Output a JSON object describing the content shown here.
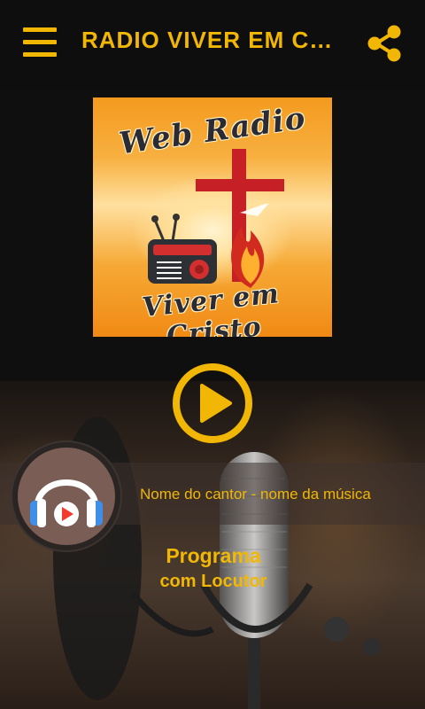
{
  "header": {
    "title": "RADIO VIVER EM CRIS...",
    "menu_icon": "hamburger-menu-icon",
    "share_icon": "share-icon"
  },
  "logo": {
    "line1": "Web Radio",
    "line2": "Viver em Cristo"
  },
  "player": {
    "play_icon": "play-icon",
    "now_playing": "Nome do cantor - nome da música",
    "avatar_icon": "headphones-play-icon"
  },
  "program": {
    "title": "Programa",
    "host": "com Locutor"
  },
  "colors": {
    "accent": "#f2b705",
    "background": "#0f0f0f",
    "cross": "#c62026"
  }
}
